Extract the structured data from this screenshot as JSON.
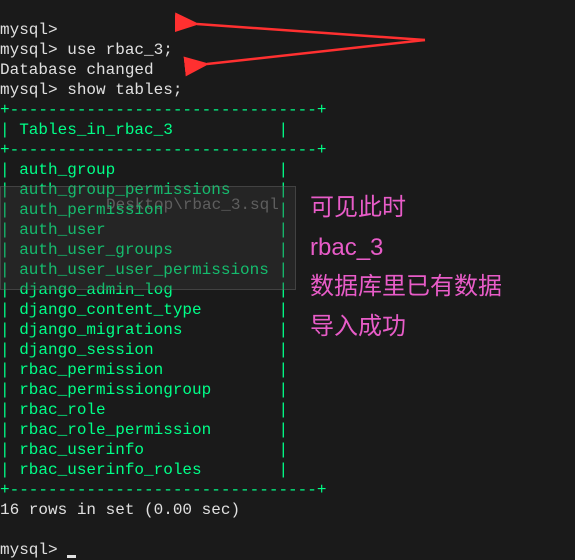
{
  "prompt_prefix": "mysql>",
  "lines": {
    "empty_prompt": "mysql>",
    "cmd1": "mysql> use rbac_3;",
    "response1": "Database changed",
    "cmd2": "mysql> show tables;",
    "ghost_path": "Desktop\\rbac_3.sql",
    "border_top": "+--------------------------------+",
    "header_row": "| Tables_in_rbac_3           |",
    "border_mid": "+--------------------------------+",
    "border_bot": "+--------------------------------+",
    "result": "16 rows in set (0.00 sec)",
    "final_prompt": "mysql> "
  },
  "table_rows": [
    "auth_group",
    "auth_group_permissions",
    "auth_permission",
    "auth_user",
    "auth_user_groups",
    "auth_user_user_permissions",
    "django_admin_log",
    "django_content_type",
    "django_migrations",
    "django_session",
    "rbac_permission",
    "rbac_permissiongroup",
    "rbac_role",
    "rbac_role_permission",
    "rbac_userinfo",
    "rbac_userinfo_roles"
  ],
  "annotation": {
    "line1": "可见此时",
    "line2": "rbac_3",
    "line3": "数据库里已有数据",
    "line4": "导入成功"
  }
}
